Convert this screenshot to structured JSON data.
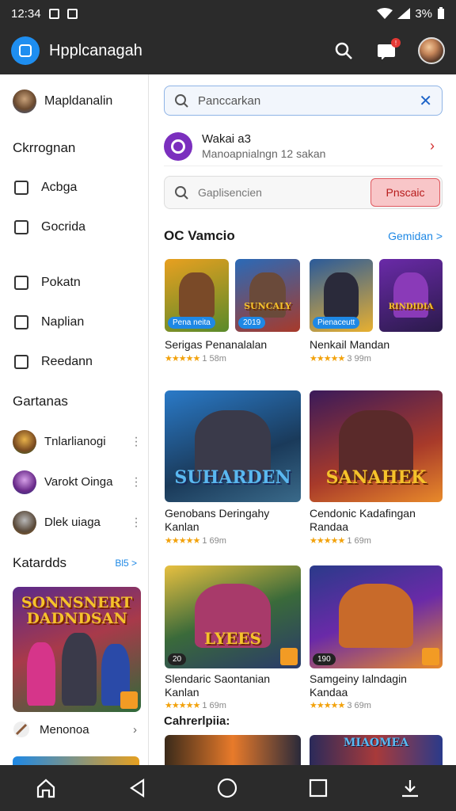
{
  "status": {
    "time": "12:34",
    "battery": "3%"
  },
  "app": {
    "title": "Hpplcanagah",
    "notif_badge": "!"
  },
  "sidebar": {
    "user": "Mapldanalin",
    "section1": "Ckrrognan",
    "items1": [
      "Acbga",
      "Gocrida"
    ],
    "items2": [
      "Pokatn",
      "Naplian",
      "Reedann"
    ],
    "section2": "Gartanas",
    "games": [
      "Tnlarlianogi",
      "Varokt Oinga",
      "Dlek uiaga"
    ],
    "categories": "Katardds",
    "categories_more": "Bl5 >",
    "banner_title": "SONNSNERT DADNDSAN",
    "footer": "Menonoa"
  },
  "main": {
    "search_placeholder": "Panccarkan",
    "search_clear": "✕",
    "notif_title": "Wakai a3",
    "notif_sub": "Manoapnialngn 12 sakan",
    "search2_placeholder": "Gaplisencien",
    "search2_button": "Pnscaic",
    "section_title": "OC Vamcio",
    "section_more": "Gemidan >",
    "games_row1": [
      {
        "title": "Serigas Penanalalan",
        "rating": "★★★★★",
        "size": "1 58m",
        "label": "Pena neita"
      },
      {
        "title": "",
        "rating": "",
        "size": "",
        "label": "2019",
        "art": "SUNCALY"
      },
      {
        "title": "Nenkail Mandan",
        "rating": "★★★★★",
        "size": "3 99m",
        "label": "Pienaceutt"
      },
      {
        "title": "",
        "rating": "",
        "size": "",
        "label": "",
        "art": "RINDIDIA"
      }
    ],
    "games_row2": [
      {
        "title": "Genobans Deringahy Kanlan",
        "rating": "★★★★★",
        "size": "1 69m",
        "art": "SUHARDEN"
      },
      {
        "title": "Cendonic Kadafingan Randaa",
        "rating": "★★★★★",
        "size": "1 69m",
        "art": "SANAHEK"
      }
    ],
    "games_row3": [
      {
        "title": "Slendaric Saontanian Kanlan",
        "rating": "★★★★★",
        "size": "1 69m",
        "art": "LYEES",
        "label": "20"
      },
      {
        "title": "Samgeiny Ialndagin Kandaa",
        "rating": "★★★★★",
        "size": "3 69m",
        "label": "190"
      }
    ],
    "sub_section": "Cahrerlpiia:",
    "bottom_art": "MIAOMEA"
  },
  "colors": {
    "accent": "#1e88e5",
    "bar": "#2b2b2b",
    "alert": "#e05a60"
  }
}
